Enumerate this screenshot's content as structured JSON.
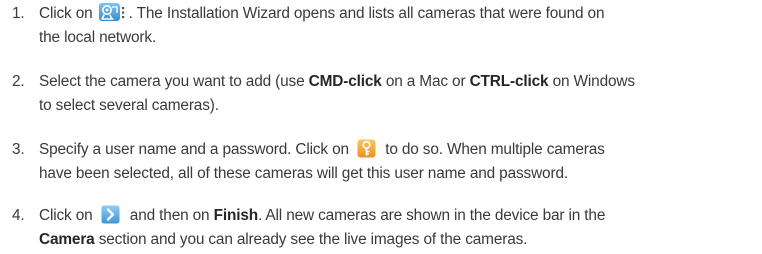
{
  "steps": [
    {
      "number": "1.",
      "part1": "Click on ",
      "icon": "camera-wizard-icon",
      "part2": ". The Installation Wizard opens and lists all cameras that were found on",
      "line2": "the local network."
    },
    {
      "number": "2.",
      "part1": "Select the camera you want to add (use ",
      "bold1": "CMD-click",
      "part2": " on a Mac or ",
      "bold2": "CTRL-click",
      "part3": " on Windows",
      "line2": "to select several cameras)."
    },
    {
      "number": "3.",
      "part1": "Specify a user name and a password. Click on ",
      "icon": "key-icon",
      "part2": " to do so. When multiple cameras",
      "line2": "have been selected, all of these cameras will get this user name and password."
    },
    {
      "number": "4.",
      "part1": "Click on ",
      "icon": "next-arrow-icon",
      "part2": " and then on ",
      "bold1": "Finish",
      "part3": ". All new cameras are shown in the device bar in the",
      "line2_bold": "Camera",
      "line2": " section and you can already see the live images of the cameras."
    }
  ],
  "colors": {
    "text": "#3a3a3a",
    "icon_blue": "#4aa0d8",
    "icon_orange": "#f0a23a"
  }
}
